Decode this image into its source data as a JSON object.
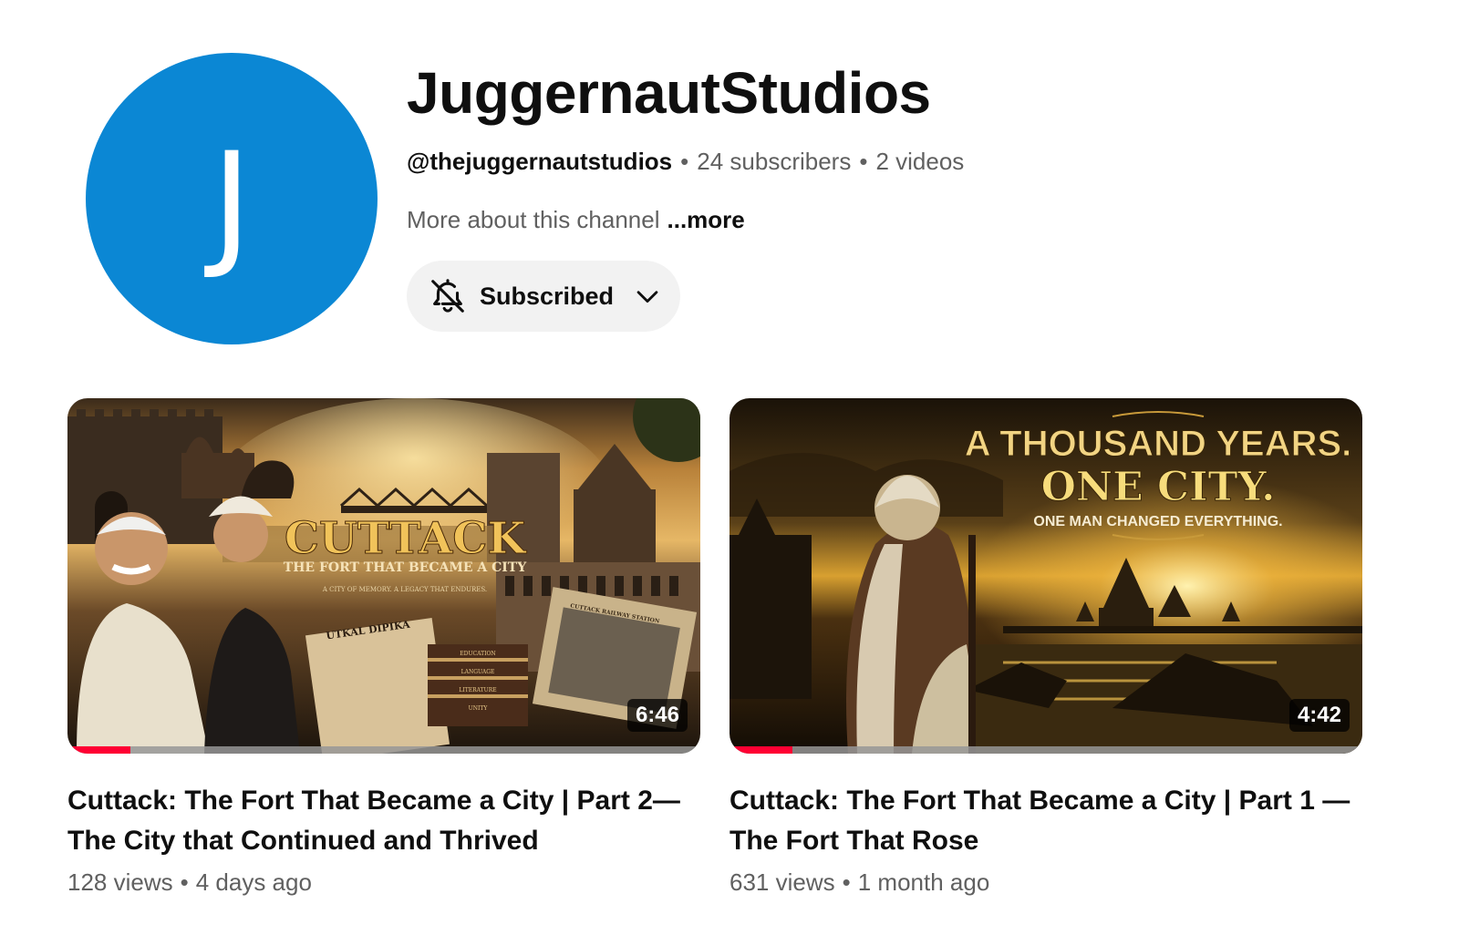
{
  "channel": {
    "avatar_letter": "J",
    "avatar_color": "#0b87d4",
    "name": "JuggernautStudios",
    "handle": "@thejuggernautstudios",
    "subscribers": "24 subscribers",
    "videos_count": "2 videos",
    "about": "More about this channel",
    "more_link": "...more",
    "subscribe_button": {
      "label": "Subscribed",
      "icon": "bell-off-icon",
      "dropdown_icon": "chevron-down-icon"
    }
  },
  "videos": [
    {
      "title": "Cuttack: The Fort That Became a City | Part 2— The City that Continued and Thrived",
      "views": "128 views",
      "age": "4 days ago",
      "duration": "6:46",
      "watch_progress": 0.1,
      "thumbnail_text": {
        "headline": "CUTTACK",
        "subhead": "THE FORT THAT BECAME A CITY",
        "tagline": "A CITY OF MEMORY. A LEGACY THAT ENDURES.",
        "newspaper": "UTKAL DIPIKA",
        "books": [
          "EDUCATION",
          "LANGUAGE",
          "LITERATURE",
          "UNITY"
        ],
        "photo_caption": "CUTTACK RAILWAY STATION"
      }
    },
    {
      "title": "Cuttack: The Fort That Became a City | Part 1 — The Fort That Rose",
      "views": "631 views",
      "age": "1 month ago",
      "duration": "4:42",
      "watch_progress": 0.1,
      "thumbnail_text": {
        "line1": "A THOUSAND YEARS.",
        "line2": "ONE CITY.",
        "line3": "ONE MAN CHANGED EVERYTHING."
      }
    }
  ],
  "colors": {
    "accent_progress": "#ff0033",
    "button_bg": "#f2f2f2",
    "secondary_text": "#606060"
  }
}
